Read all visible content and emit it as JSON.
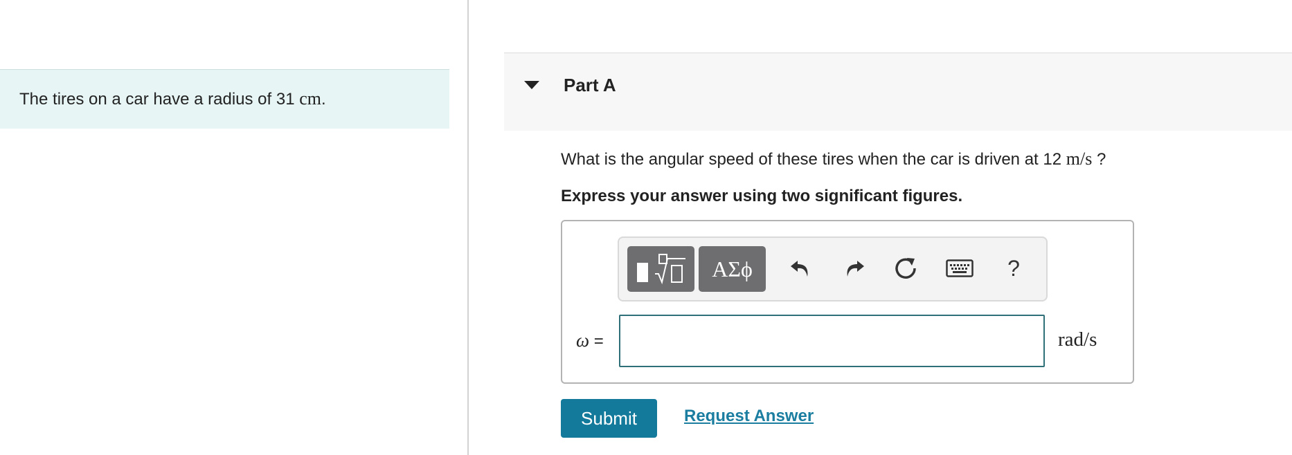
{
  "problem": {
    "text_before": "The tires on a car have a radius of 31 ",
    "unit": "cm",
    "text_after": "."
  },
  "part": {
    "title": "Part A"
  },
  "question": {
    "text_before": "What is the angular speed of these tires when the car is driven at 12 ",
    "unit": "m/s",
    "text_after": " ?"
  },
  "instruction": "Express your answer using two significant figures.",
  "toolbar": {
    "symbols_label": "ΑΣϕ",
    "help_label": "?",
    "icons": [
      "templates-icon",
      "greek-symbols-icon",
      "undo-icon",
      "redo-icon",
      "reset-icon",
      "keyboard-icon",
      "help-icon"
    ]
  },
  "answer": {
    "variable_symbol": "ω",
    "variable_equals": " =",
    "value": "",
    "units": "rad/s"
  },
  "actions": {
    "submit_label": "Submit",
    "request_label": "Request Answer"
  },
  "colors": {
    "problem_bg": "#e7f5f5",
    "submit_bg": "#147a9c",
    "link": "#1b7ea0",
    "input_border": "#2f6f78",
    "toolbar_button": "#6e6e70"
  }
}
